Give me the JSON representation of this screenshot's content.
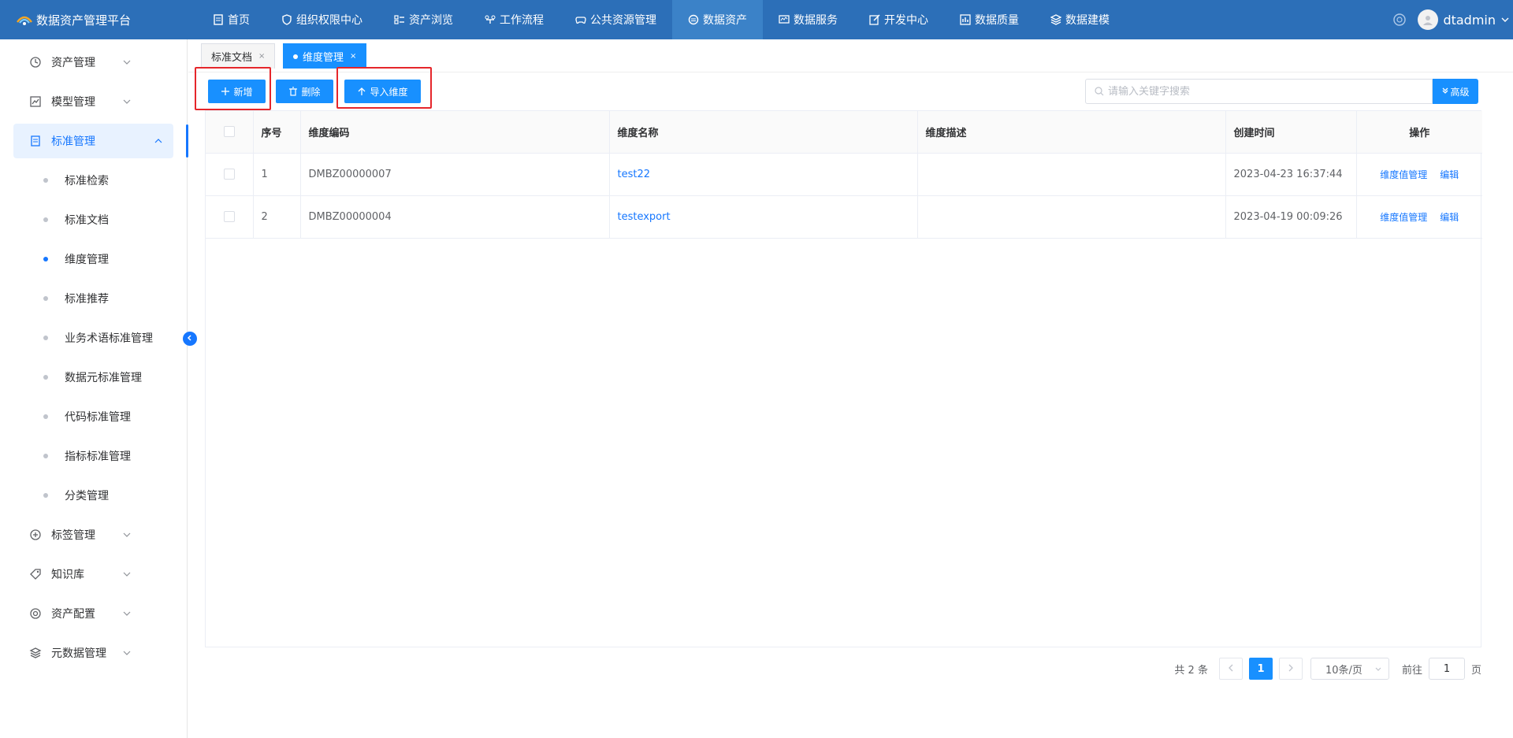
{
  "app": {
    "title": "数据资产管理平台"
  },
  "header": {
    "nav": [
      {
        "label": "首页",
        "icon": "document-icon"
      },
      {
        "label": "组织权限中心",
        "icon": "shield-icon"
      },
      {
        "label": "资产浏览",
        "icon": "list-icon"
      },
      {
        "label": "工作流程",
        "icon": "workflow-icon"
      },
      {
        "label": "公共资源管理",
        "icon": "gamepad-icon"
      },
      {
        "label": "数据资产",
        "icon": "database-icon",
        "active": true
      },
      {
        "label": "数据服务",
        "icon": "monitor-icon"
      },
      {
        "label": "开发中心",
        "icon": "edit-icon"
      },
      {
        "label": "数据质量",
        "icon": "chart-icon"
      },
      {
        "label": "数据建模",
        "icon": "layers-icon"
      }
    ],
    "user": {
      "name": "dtadmin"
    }
  },
  "sidebar": {
    "menus": [
      {
        "label": "资产管理",
        "icon": "clock-icon"
      },
      {
        "label": "模型管理",
        "icon": "trend-icon"
      },
      {
        "label": "标准管理",
        "icon": "document-icon",
        "open": true
      },
      {
        "label": "标签管理",
        "icon": "plus-circle-icon"
      },
      {
        "label": "知识库",
        "icon": "tag-icon"
      },
      {
        "label": "资产配置",
        "icon": "target-icon"
      },
      {
        "label": "元数据管理",
        "icon": "layers-icon"
      }
    ],
    "submenu": [
      {
        "label": "标准检索"
      },
      {
        "label": "标准文档"
      },
      {
        "label": "维度管理",
        "active": true
      },
      {
        "label": "标准推荐"
      },
      {
        "label": "业务术语标准管理"
      },
      {
        "label": "数据元标准管理"
      },
      {
        "label": "代码标准管理"
      },
      {
        "label": "指标标准管理"
      },
      {
        "label": "分类管理"
      }
    ]
  },
  "tabs": [
    {
      "label": "标准文档",
      "close": "×"
    },
    {
      "label": "维度管理",
      "close": "×",
      "active": true
    }
  ],
  "toolbar": {
    "add_label": "新增",
    "delete_label": "删除",
    "import_label": "导入维度"
  },
  "search": {
    "placeholder": "请输入关键字搜索",
    "advanced_label": "高级"
  },
  "table": {
    "columns": [
      "序号",
      "维度编码",
      "维度名称",
      "维度描述",
      "创建时间",
      "操作"
    ],
    "rows": [
      {
        "index": "1",
        "code": "DMBZ00000007",
        "name": "test22",
        "desc": "",
        "created": "2023-04-23 16:37:44",
        "action_values": "维度值管理",
        "action_edit": "编辑"
      },
      {
        "index": "2",
        "code": "DMBZ00000004",
        "name": "testexport",
        "desc": "",
        "created": "2023-04-19 00:09:26",
        "action_values": "维度值管理",
        "action_edit": "编辑"
      }
    ]
  },
  "pagination": {
    "total_text": "共 2 条",
    "current_page": "1",
    "page_size": "10条/页",
    "goto_prefix": "前往",
    "goto_value": "1",
    "goto_suffix": "页"
  },
  "colors": {
    "header_bg": "#2c6fb8",
    "primary": "#1890ff",
    "highlight": "#e5262b"
  }
}
